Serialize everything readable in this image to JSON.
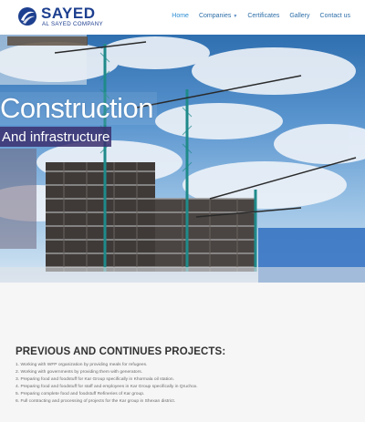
{
  "brand": {
    "name": "SAYED",
    "subtitle": "AL SAYED COMPANY",
    "logo_icon": "sayed-globe-logo",
    "color": "#1d3f8f"
  },
  "nav": {
    "items": [
      {
        "label": "Home",
        "active": true
      },
      {
        "label": "Companies",
        "dropdown": true
      },
      {
        "label": "Certificates"
      },
      {
        "label": "Gallery"
      },
      {
        "label": "Contact us"
      }
    ]
  },
  "hero": {
    "title": "Construction",
    "subtitle": "And infrastructure"
  },
  "projects": {
    "title": "PREVIOUS AND CONTINUES PROJECTS:",
    "items": [
      "1. Working with WFP organization by providing meals for refugees.",
      "2. Working with governments by providing them with generators.",
      "3. Preparing food and foodstuff for Kar Group specifically in Khormala oil station.",
      "4. Preparing food and foodstuff for staff and employees in Kar Group specifically in Qruchox.",
      "5. Preparing complete food and foodstuff Refineries of Kar group.",
      "6. Full contracting and processing of projects for the Kar group in Shexan district."
    ]
  }
}
